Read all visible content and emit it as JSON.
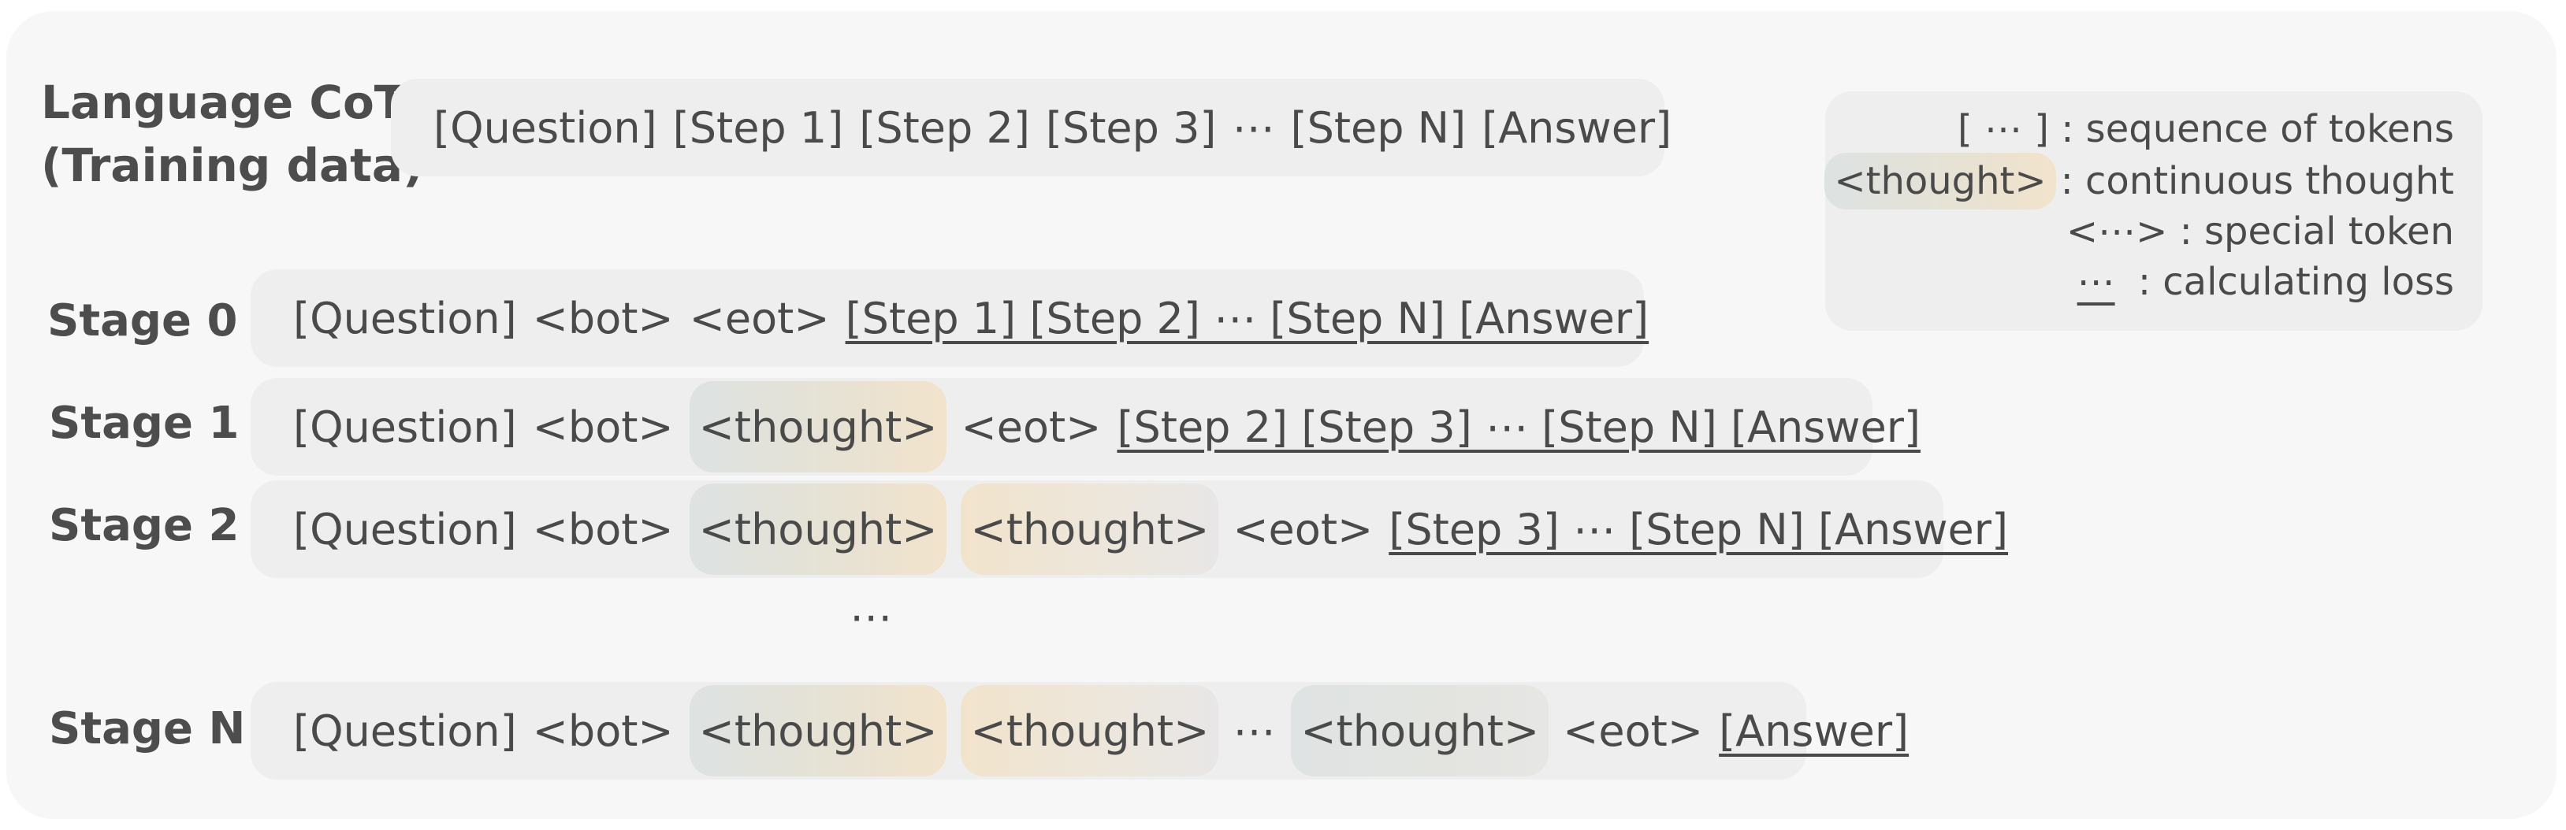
{
  "language_cot": {
    "label_line1": "Language CoT",
    "label_line2": "(Training data)",
    "tokens": [
      "[Question]",
      "[Step 1]",
      "[Step 2]",
      "[Step 3]",
      "⋯",
      "[Step N]",
      "[Answer]"
    ]
  },
  "legend": {
    "seq_key": "[ ⋯ ]",
    "seq_desc": ": sequence of tokens",
    "thought_key": "<thought>",
    "thought_desc": ": continuous thought",
    "special_key": "<⋯>",
    "special_desc": ": special token",
    "loss_key": "⋯",
    "loss_desc": ": calculating loss"
  },
  "stages": [
    {
      "label": "Stage 0",
      "prefix": [
        "[Question]",
        "<bot>"
      ],
      "thoughts": [],
      "eot": "<eot>",
      "loss": "[Step 1] [Step 2] ⋯ [Step N] [Answer]"
    },
    {
      "label": "Stage 1",
      "prefix": [
        "[Question]",
        "<bot>"
      ],
      "thoughts": [
        "<thought>"
      ],
      "eot": "<eot>",
      "loss": "[Step 2] [Step 3] ⋯ [Step N] [Answer]"
    },
    {
      "label": "Stage 2",
      "prefix": [
        "[Question]",
        "<bot>"
      ],
      "thoughts": [
        "<thought>",
        "<thought>"
      ],
      "eot": "<eot>",
      "loss": "[Step 3] ⋯ [Step N] [Answer]"
    },
    {
      "label": "Stage N",
      "prefix": [
        "[Question]",
        "<bot>"
      ],
      "thoughts": [
        "<thought>",
        "<thought>"
      ],
      "mid_ellipsis": "⋯",
      "last_thought": "<thought>",
      "eot": "<eot>",
      "loss": "[Answer]"
    }
  ],
  "between_ellipsis": "⋯"
}
